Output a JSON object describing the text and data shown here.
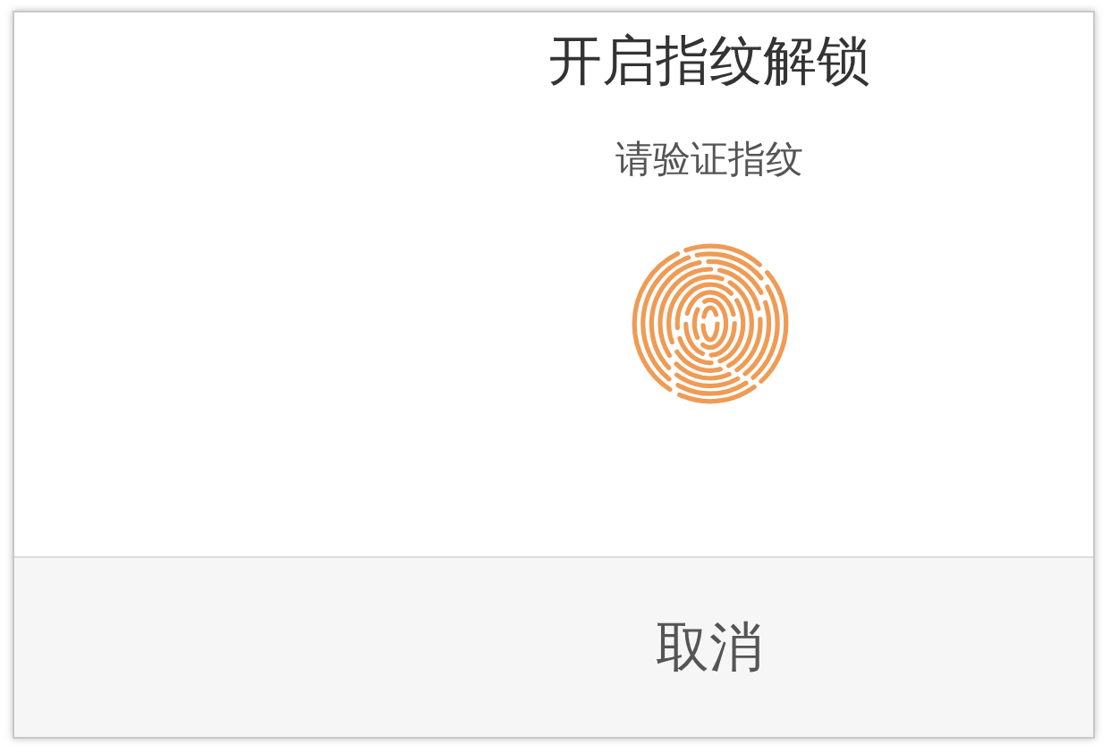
{
  "dialog": {
    "title": "开启指纹解锁",
    "subtitle": "请验证指纹"
  },
  "buttons": [
    "取消"
  ]
}
